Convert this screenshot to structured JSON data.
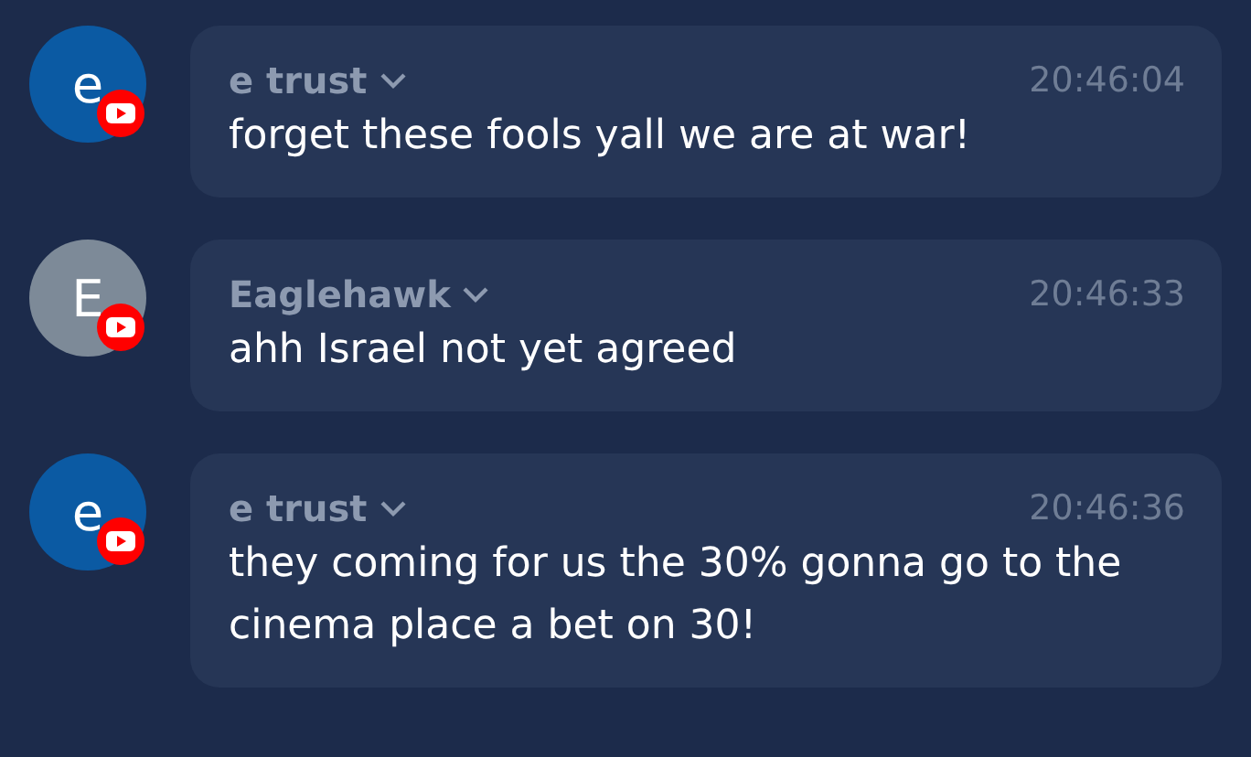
{
  "messages": [
    {
      "avatar_letter": "e",
      "color": "#0b5aa3",
      "author": "e trust",
      "time": "20:46:04",
      "text": "forget these fools yall we are at war!"
    },
    {
      "avatar_letter": "E",
      "color": "#7d8a98",
      "author": "Eaglehawk",
      "time": "20:46:33",
      "text": "ahh Israel not yet agreed"
    },
    {
      "avatar_letter": "e",
      "color": "#0b5aa3",
      "author": "e trust",
      "time": "20:46:36",
      "text": "they coming for us the 30% gonna go to the cinema place a bet on 30!"
    }
  ]
}
